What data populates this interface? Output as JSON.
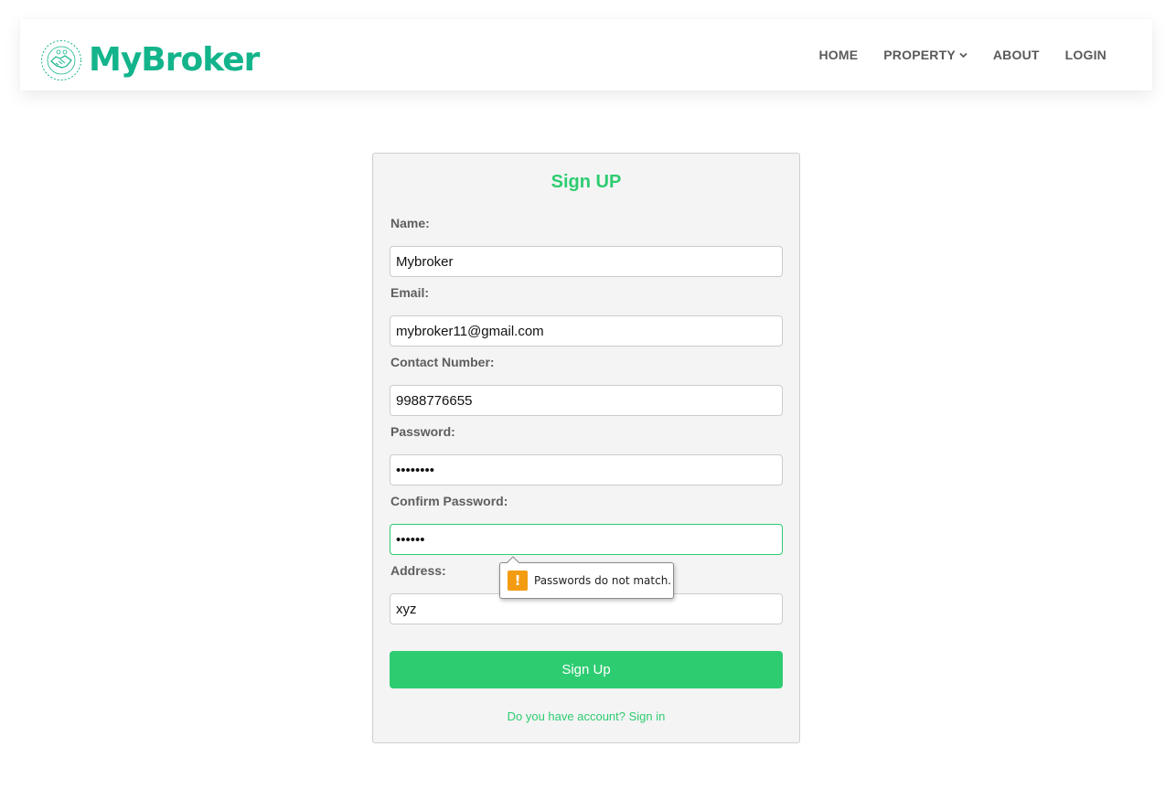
{
  "brand": {
    "name": "MyBroker",
    "color": "#13b48b",
    "logo_icon": "handshake-icon"
  },
  "nav": {
    "home": "HOME",
    "property": "PROPERTY",
    "about": "ABOUT",
    "login": "LOGIN"
  },
  "form": {
    "title": "Sign UP",
    "name_label": "Name:",
    "name_value": "Mybroker",
    "email_label": "Email:",
    "email_value": "mybroker11@gmail.com",
    "contact_label": "Contact Number:",
    "contact_value": "9988776655",
    "password_label": "Password:",
    "password_value": "12345678",
    "confirm_label": "Confirm Password:",
    "confirm_value": "123456",
    "address_label": "Address:",
    "address_value": "xyz",
    "submit_label": "Sign Up",
    "signin_text": "Do you have account? Sign in"
  },
  "validation": {
    "message": "Passwords do not match.",
    "icon": "warning-icon",
    "color": "#f39c12"
  },
  "colors": {
    "accent": "#2ecc71"
  }
}
